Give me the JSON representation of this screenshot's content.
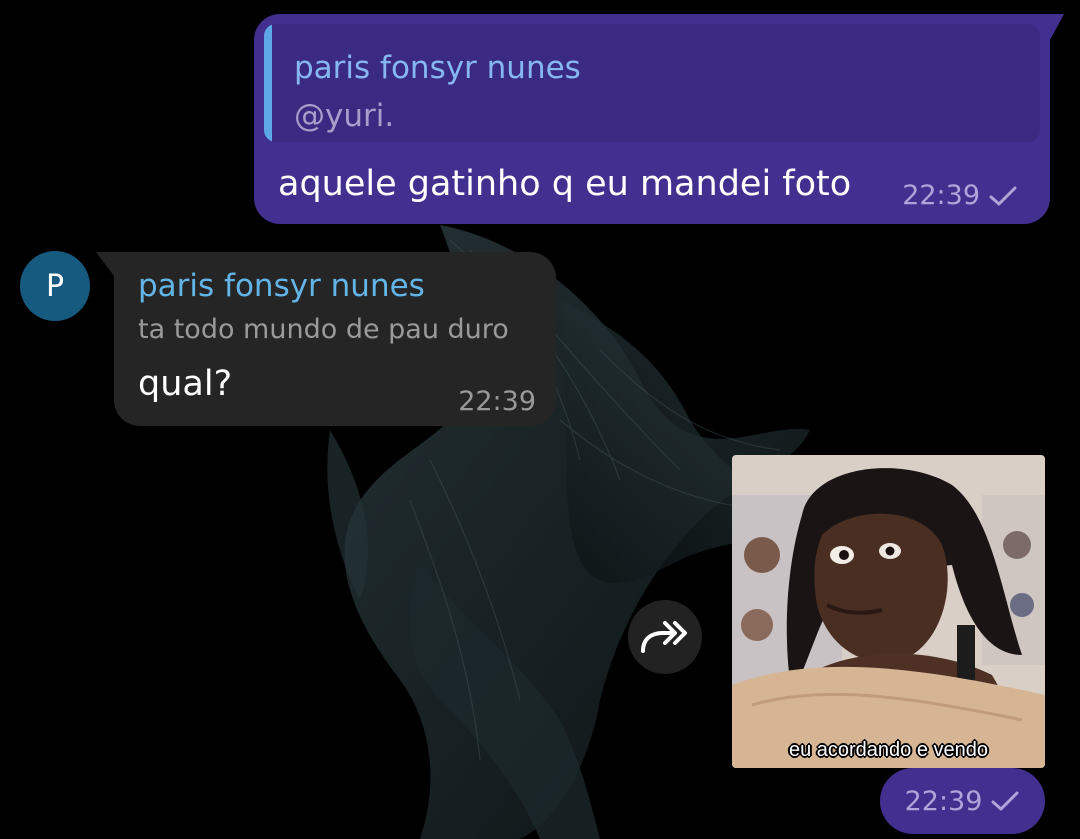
{
  "outgoing_reply": {
    "quoted_author": "paris fonsyr nunes",
    "quoted_text": "@yuri.",
    "text": "aquele gatinho q eu mandei foto",
    "time": "22:39"
  },
  "incoming": {
    "avatar_initial": "P",
    "author": "paris fonsyr nunes",
    "quoted_text": "ta todo mundo de pau duro",
    "text": "qual?",
    "time": "22:39"
  },
  "photo_message": {
    "caption": "eu acordando e vendo",
    "time": "22:39"
  },
  "icons": {
    "forward": "forward-icon",
    "sent_check": "check-icon"
  },
  "colors": {
    "outgoing_bubble": "#41308f",
    "incoming_bubble": "#252525",
    "author_name": "#63b5e8",
    "avatar": "#175a80"
  }
}
